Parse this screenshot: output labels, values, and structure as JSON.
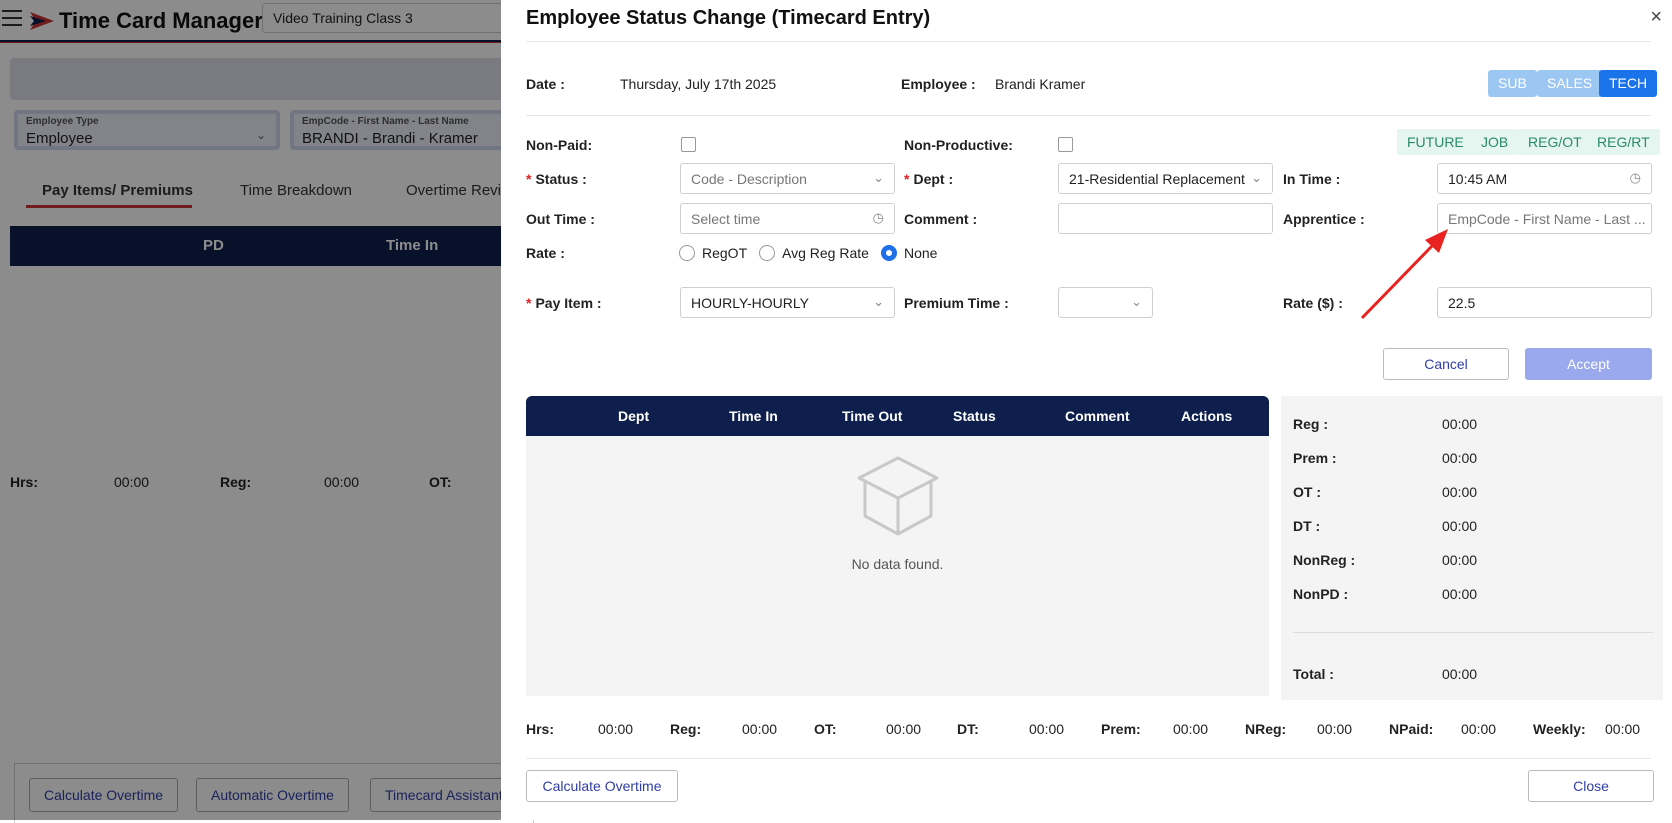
{
  "app": {
    "title": "Time Card Manager",
    "class_select": "Video Training Class 3"
  },
  "background": {
    "employee_type": {
      "label": "Employee Type",
      "value": "Employee"
    },
    "empcode": {
      "label": "EmpCode - First Name - Last Name",
      "value": "BRANDI - Brandi - Kramer"
    },
    "tabs": [
      "Pay Items/ Premiums",
      "Time Breakdown",
      "Overtime Revie"
    ],
    "table_headers": [
      "PD",
      "Time In"
    ],
    "hrs": {
      "hrs_label": "Hrs:",
      "hrs_val": "00:00",
      "reg_label": "Reg:",
      "reg_val": "00:00",
      "ot_label": "OT:"
    },
    "buttons": [
      "Calculate Overtime",
      "Automatic Overtime",
      "Timecard Assistant"
    ]
  },
  "dialog": {
    "title": "Employee Status Change (Timecard Entry)",
    "close_icon": "×",
    "date_label": "Date",
    "date_value": "Thursday, July 17th 2025",
    "employee_label": "Employee",
    "employee_value": "Brandi Kramer",
    "mode_pills": [
      {
        "label": "SUB",
        "color": "#9cc7f2"
      },
      {
        "label": "SALES",
        "color": "#9cc7f2"
      },
      {
        "label": "TECH",
        "color": "#1a73e8"
      }
    ],
    "tags": [
      "FUTURE",
      "JOB",
      "REG/OT",
      "REG/RT"
    ],
    "nonpaid_label": "Non-Paid",
    "nonproductive_label": "Non-Productive",
    "status_label": "Status",
    "status_placeholder": "Code - Description",
    "dept_label": "Dept",
    "dept_value": "21-Residential Replacement",
    "intime_label": "In Time",
    "intime_value": "10:45 AM",
    "outtime_label": "Out Time",
    "outtime_placeholder": "Select time",
    "comment_label": "Comment",
    "comment_value": "",
    "apprentice_label": "Apprentice",
    "apprentice_placeholder": "EmpCode - First Name - Last ...",
    "rate_label": "Rate",
    "rate_options": [
      "RegOT",
      "Avg Reg Rate",
      "None"
    ],
    "rate_selected": "None",
    "payitem_label": "Pay Item",
    "payitem_value": "HOURLY-HOURLY",
    "premium_label": "Premium Time",
    "premium_value": "",
    "rate_dollar_label": "Rate ($)",
    "rate_dollar_value": "22.5",
    "cancel_label": "Cancel",
    "accept_label": "Accept",
    "table_headers": [
      "Dept",
      "Time In",
      "Time Out",
      "Status",
      "Comment",
      "Actions"
    ],
    "empty_text": "No data found.",
    "summary": [
      {
        "label": "Reg",
        "value": "00:00"
      },
      {
        "label": "Prem",
        "value": "00:00"
      },
      {
        "label": "OT",
        "value": "00:00"
      },
      {
        "label": "DT",
        "value": "00:00"
      },
      {
        "label": "NonReg",
        "value": "00:00"
      },
      {
        "label": "NonPD",
        "value": "00:00"
      }
    ],
    "summary_total": {
      "label": "Total",
      "value": "00:00"
    },
    "totals": [
      {
        "label": "Hrs:",
        "value": "00:00"
      },
      {
        "label": "Reg:",
        "value": "00:00"
      },
      {
        "label": "OT:",
        "value": "00:00"
      },
      {
        "label": "DT:",
        "value": "00:00"
      },
      {
        "label": "Prem:",
        "value": "00:00"
      },
      {
        "label": "NReg:",
        "value": "00:00"
      },
      {
        "label": "NPaid:",
        "value": "00:00"
      },
      {
        "label": "Weekly:",
        "value": "00:00"
      }
    ],
    "calc_overtime_label": "Calculate Overtime",
    "close_label": "Close"
  }
}
